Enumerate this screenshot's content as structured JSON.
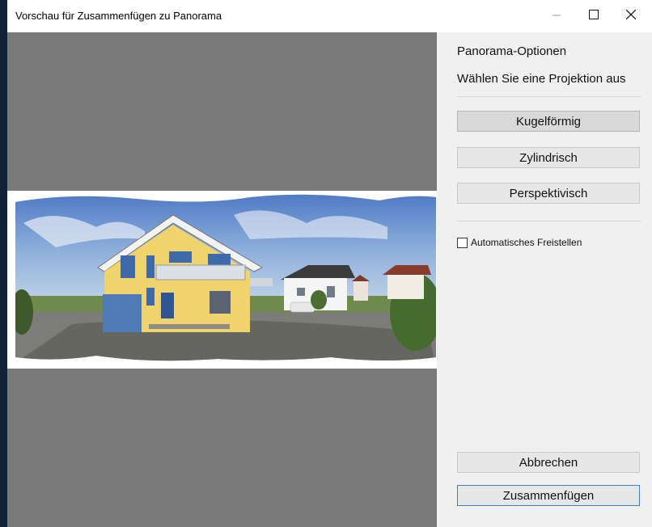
{
  "window": {
    "title": "Vorschau für Zusammenfügen zu Panorama"
  },
  "titlebar_buttons": {
    "minimize_icon": "minimize-icon",
    "maximize_icon": "maximize-icon",
    "close_icon": "close-icon"
  },
  "options": {
    "heading": "Panorama-Optionen",
    "subheading": "Wählen Sie eine Projektion aus",
    "projections": [
      {
        "label": "Kugelförmig",
        "selected": true
      },
      {
        "label": "Zylindrisch",
        "selected": false
      },
      {
        "label": "Perspektivisch",
        "selected": false
      }
    ],
    "autocrop": {
      "label": "Automatisches Freistellen",
      "checked": false
    }
  },
  "actions": {
    "cancel_label": "Abbrechen",
    "stitch_label": "Zusammenfügen"
  },
  "colors": {
    "preview_bg": "#7a7a7a",
    "accent": "#3c7fd6"
  }
}
